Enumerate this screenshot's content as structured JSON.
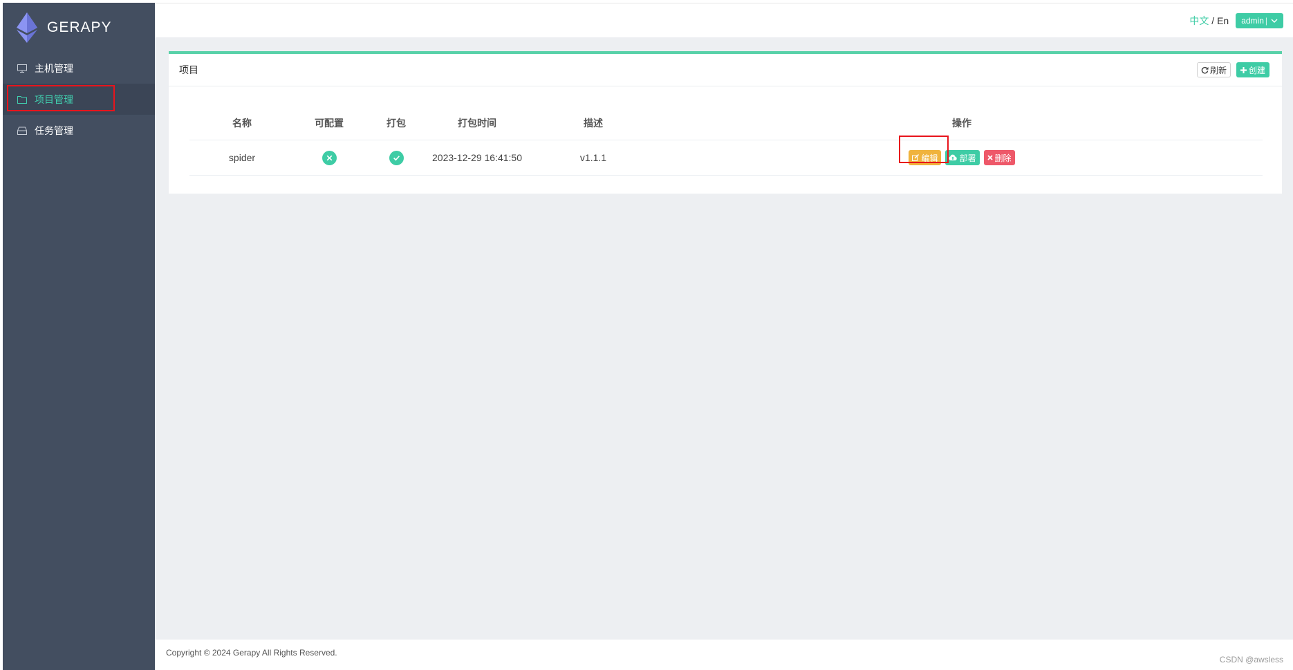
{
  "brand": {
    "name": "GERAPY"
  },
  "sidebar": {
    "items": [
      {
        "label": "主机管理",
        "icon": "monitor-icon"
      },
      {
        "label": "项目管理",
        "icon": "folder-icon"
      },
      {
        "label": "任务管理",
        "icon": "task-icon"
      }
    ],
    "active_index": 1
  },
  "topbar": {
    "lang_zh": "中文",
    "lang_sep": "/",
    "lang_en": "En",
    "user": "admin",
    "user_sep": "|"
  },
  "project_card": {
    "title": "项目",
    "refresh_label": "刷新",
    "create_label": "创建"
  },
  "table": {
    "headers": [
      "名称",
      "可配置",
      "打包",
      "打包时间",
      "描述",
      "操作"
    ],
    "rows": [
      {
        "name": "spider",
        "configurable": false,
        "packaged": true,
        "build_time": "2023-12-29 16:41:50",
        "description": "v1.1.1",
        "actions": [
          "编辑",
          "部署",
          "删除"
        ]
      }
    ]
  },
  "footer": {
    "copyright": "Copyright © 2024 Gerapy All Rights Reserved.",
    "watermark": "CSDN @awsless"
  },
  "colors": {
    "sidebar": "#434e60",
    "accent": "#3ecca5",
    "edit": "#f0b33d",
    "delete": "#ee5869",
    "highlight": "#e8141c"
  }
}
